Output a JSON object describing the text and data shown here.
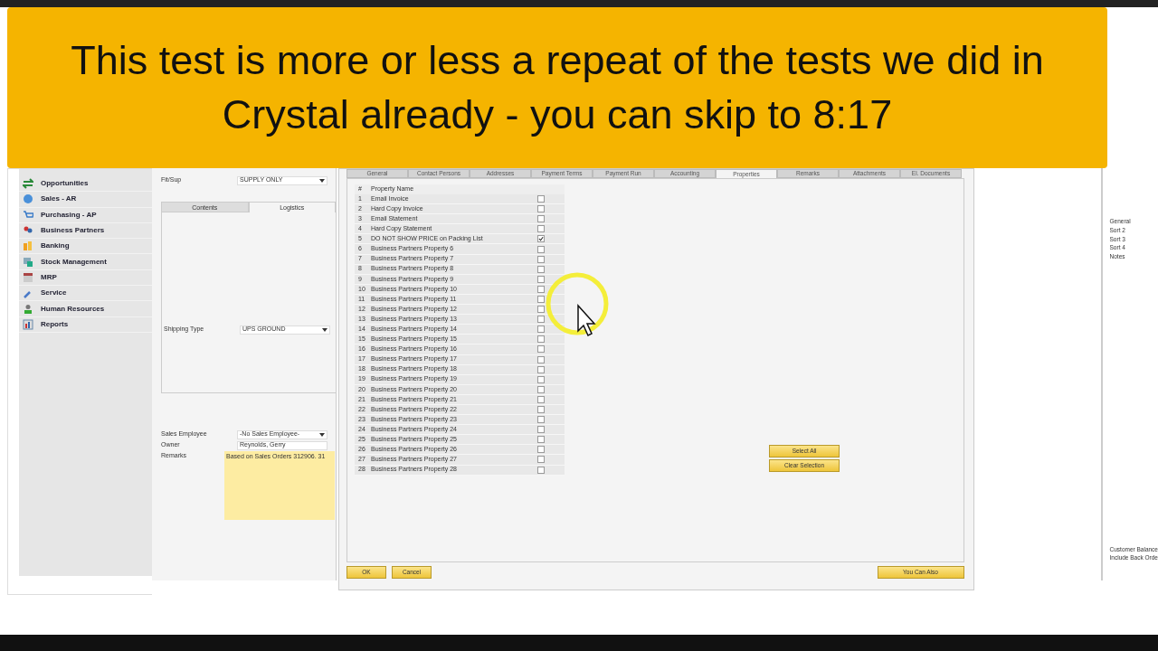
{
  "banner": {
    "text": "This test is more or less a repeat of the tests we did in Crystal already - you can skip to 8:17"
  },
  "sidebar": {
    "items": [
      {
        "label": "Opportunities"
      },
      {
        "label": "Sales - AR"
      },
      {
        "label": "Purchasing - AP"
      },
      {
        "label": "Business Partners"
      },
      {
        "label": "Banking"
      },
      {
        "label": "Stock Management"
      },
      {
        "label": "MRP"
      },
      {
        "label": "Service"
      },
      {
        "label": "Human Resources"
      },
      {
        "label": "Reports"
      }
    ]
  },
  "document": {
    "fit_sup": {
      "label": "Fit/Sup",
      "value": "SUPPLY ONLY"
    },
    "tabs": [
      {
        "label": "Contents",
        "selected": false
      },
      {
        "label": "Logistics",
        "selected": true
      }
    ],
    "shipping_type": {
      "label": "Shipping Type",
      "value": "UPS GROUND"
    },
    "sales_employee": {
      "label": "Sales Employee",
      "value": "-No Sales Employee-"
    },
    "owner": {
      "label": "Owner",
      "value": "Reynolds, Gerry"
    },
    "remarks": {
      "label": "Remarks",
      "value": "Based on Sales Orders 312906. 31"
    }
  },
  "business_partner": {
    "tabs": [
      {
        "label": "General",
        "selected": false
      },
      {
        "label": "Contact Persons",
        "selected": false
      },
      {
        "label": "Addresses",
        "selected": false
      },
      {
        "label": "Payment Terms",
        "selected": false
      },
      {
        "label": "Payment Run",
        "selected": false
      },
      {
        "label": "Accounting",
        "selected": false
      },
      {
        "label": "Properties",
        "selected": true
      },
      {
        "label": "Remarks",
        "selected": false
      },
      {
        "label": "Attachments",
        "selected": false
      },
      {
        "label": "El. Documents",
        "selected": false
      }
    ],
    "columns": [
      "#",
      "Property Name"
    ],
    "properties": [
      {
        "num": "1",
        "name": "Email Invoice",
        "checked": false
      },
      {
        "num": "2",
        "name": "Hard Copy Invoice",
        "checked": false
      },
      {
        "num": "3",
        "name": "Email Statement",
        "checked": false
      },
      {
        "num": "4",
        "name": "Hard Copy Statement",
        "checked": false
      },
      {
        "num": "5",
        "name": "DO NOT SHOW PRICE on Packing List",
        "checked": true
      },
      {
        "num": "6",
        "name": "Business Partners Property 6",
        "checked": false
      },
      {
        "num": "7",
        "name": "Business Partners Property 7",
        "checked": false
      },
      {
        "num": "8",
        "name": "Business Partners Property 8",
        "checked": false
      },
      {
        "num": "9",
        "name": "Business Partners Property 9",
        "checked": false
      },
      {
        "num": "10",
        "name": "Business Partners Property 10",
        "checked": false
      },
      {
        "num": "11",
        "name": "Business Partners Property 11",
        "checked": false
      },
      {
        "num": "12",
        "name": "Business Partners Property 12",
        "checked": false
      },
      {
        "num": "13",
        "name": "Business Partners Property 13",
        "checked": false
      },
      {
        "num": "14",
        "name": "Business Partners Property 14",
        "checked": false
      },
      {
        "num": "15",
        "name": "Business Partners Property 15",
        "checked": false
      },
      {
        "num": "16",
        "name": "Business Partners Property 16",
        "checked": false
      },
      {
        "num": "17",
        "name": "Business Partners Property 17",
        "checked": false
      },
      {
        "num": "18",
        "name": "Business Partners Property 18",
        "checked": false
      },
      {
        "num": "19",
        "name": "Business Partners Property 19",
        "checked": false
      },
      {
        "num": "20",
        "name": "Business Partners Property 20",
        "checked": false
      },
      {
        "num": "21",
        "name": "Business Partners Property 21",
        "checked": false
      },
      {
        "num": "22",
        "name": "Business Partners Property 22",
        "checked": false
      },
      {
        "num": "23",
        "name": "Business Partners Property 23",
        "checked": false
      },
      {
        "num": "24",
        "name": "Business Partners Property 24",
        "checked": false
      },
      {
        "num": "25",
        "name": "Business Partners Property 25",
        "checked": false
      },
      {
        "num": "26",
        "name": "Business Partners Property 26",
        "checked": false
      },
      {
        "num": "27",
        "name": "Business Partners Property 27",
        "checked": false
      },
      {
        "num": "28",
        "name": "Business Partners Property 28",
        "checked": false
      }
    ],
    "side_buttons": [
      "Select All",
      "Clear Selection"
    ],
    "footer_buttons": [
      "OK",
      "Cancel"
    ],
    "more_button": "You Can Also"
  },
  "right_panel": {
    "tab": "General",
    "sorts": [
      "Sort 2",
      "Sort 3",
      "Sort 4",
      "Notes"
    ],
    "options": [
      "Customer Balance",
      "Include Back Orde"
    ]
  }
}
